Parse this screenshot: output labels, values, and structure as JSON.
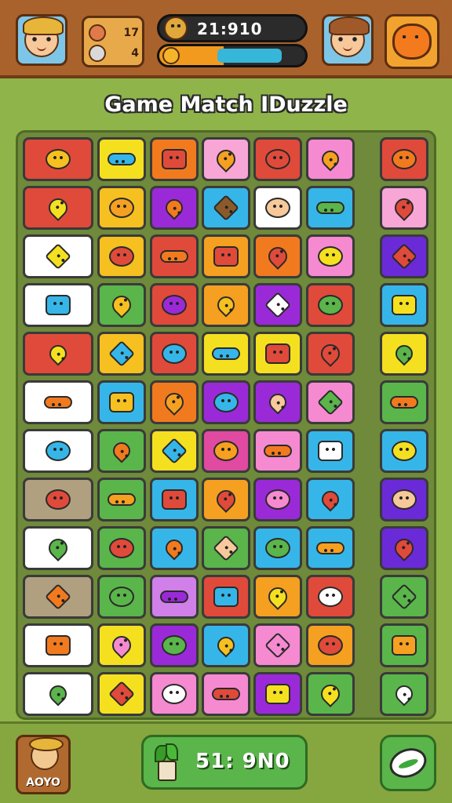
{
  "header": {
    "resources": [
      {
        "icon": "flower-icon",
        "value": "17",
        "color": "#e07a4a"
      },
      {
        "icon": "gear-icon",
        "value": "4",
        "color": "#d9d9d9"
      }
    ],
    "score_display": "21:910",
    "progress": 0.8,
    "colors": {
      "bar_bg": "#a9622c",
      "progress_orange": "#f29a1e",
      "progress_blue": "#36b6d8"
    }
  },
  "title": "Game Match IDuzzle",
  "board": {
    "columns": 8,
    "rows": 12,
    "tiles": [
      [
        "#e04a3a",
        "#f5e020",
        "#f27a1e",
        "#f7a6d6",
        "#e04a3a",
        "#f58ad0",
        "#8fb44a",
        "#e04a3a"
      ],
      [
        "#e04a3a",
        "#f5c020",
        "#9a2ad8",
        "#36b6e8",
        "#ffffff",
        "#36b6e8",
        "#8fb44a",
        "#f7a6d6"
      ],
      [
        "#ffffff",
        "#f5c020",
        "#e04a3a",
        "#f5a020",
        "#f27a1e",
        "#f58ad0",
        "#8fb44a",
        "#6a2ad8"
      ],
      [
        "#ffffff",
        "#5ab54a",
        "#e04a3a",
        "#f5a020",
        "#9a2ad8",
        "#e04a3a",
        "#8fb44a",
        "#36b6e8"
      ],
      [
        "#e04a3a",
        "#f5c020",
        "#e04a3a",
        "#f5e020",
        "#f5e020",
        "#e04a3a",
        "#8fb44a",
        "#f5e020"
      ],
      [
        "#ffffff",
        "#36b6e8",
        "#f27a1e",
        "#9a2ad8",
        "#9a2ad8",
        "#f58ad0",
        "#8fb44a",
        "#5ab54a"
      ],
      [
        "#ffffff",
        "#5ab54a",
        "#f5e020",
        "#e04aa0",
        "#f58ad0",
        "#36b6e8",
        "#8fb44a",
        "#36b6e8"
      ],
      [
        "#b0a080",
        "#5ab54a",
        "#36b6e8",
        "#f5a020",
        "#9a2ad8",
        "#36b6e8",
        "#8fb44a",
        "#6a2ad8"
      ],
      [
        "#ffffff",
        "#5ab54a",
        "#36b6e8",
        "#5ab54a",
        "#36b6e8",
        "#36b6e8",
        "#8fb44a",
        "#6a2ad8"
      ],
      [
        "#b0a080",
        "#5ab54a",
        "#d080e8",
        "#e04a3a",
        "#f5a020",
        "#e04a3a",
        "#8fb44a",
        "#5ab54a"
      ],
      [
        "#ffffff",
        "#f5e020",
        "#9a2ad8",
        "#36b6e8",
        "#f58ad0",
        "#f5a020",
        "#8fb44a",
        "#5ab54a"
      ],
      [
        "#ffffff",
        "#f5e020",
        "#f58ad0",
        "#f58ad0",
        "#9a2ad8",
        "#5ab54a",
        "#8fb44a",
        "#5ab54a"
      ]
    ],
    "glyph_colors": [
      [
        "#f5c020",
        "#36b6e8",
        "#e04a3a",
        "#f5a020",
        "#e04a3a",
        "#f5a020",
        "",
        "#f27a1e"
      ],
      [
        "#f5e020",
        "#f5a020",
        "#f27a1e",
        "#8a5a2a",
        "#f6c89a",
        "#5ab54a",
        "",
        "#e04a3a"
      ],
      [
        "#f5e020",
        "#e04a3a",
        "#f27a1e",
        "#e04a3a",
        "#e04a3a",
        "#f5e020",
        "",
        "#e04a3a"
      ],
      [
        "#36b6e8",
        "#f5c020",
        "#9a2ad8",
        "#f5c020",
        "#ffffff",
        "#5ab54a",
        "",
        "#f5e020"
      ],
      [
        "#f5e020",
        "#36b6e8",
        "#36b6e8",
        "#36b6e8",
        "#e04a3a",
        "#e04a3a",
        "",
        "#5ab54a"
      ],
      [
        "#f27a1e",
        "#f5c020",
        "#f5a020",
        "#36b6e8",
        "#f6c89a",
        "#5ab54a",
        "",
        "#f27a1e"
      ],
      [
        "#36b6e8",
        "#f27a1e",
        "#36b6e8",
        "#f5a020",
        "#f27a1e",
        "#ffffff",
        "",
        "#f5e020"
      ],
      [
        "#e04a3a",
        "#f5a020",
        "#e04a3a",
        "#e04a3a",
        "#f58ad0",
        "#e04a3a",
        "",
        "#f6c89a"
      ],
      [
        "#5ab54a",
        "#e04a3a",
        "#f27a1e",
        "#f6c89a",
        "#5ab54a",
        "#f5a020",
        "",
        "#e04a3a"
      ],
      [
        "#f27a1e",
        "#5ab54a",
        "#9a2ad8",
        "#36b6e8",
        "#f5e020",
        "#ffffff",
        "",
        "#5ab54a"
      ],
      [
        "#f27a1e",
        "#f58ad0",
        "#5ab54a",
        "#f5c020",
        "#f58ad0",
        "#e04a3a",
        "",
        "#f5a020"
      ],
      [
        "#5ab54a",
        "#e04a3a",
        "#ffffff",
        "#e04a3a",
        "#f5e020",
        "#f5e020",
        "",
        "#ffffff"
      ]
    ],
    "glyph_icons": [
      [
        "fish-icon",
        "heart-icon",
        "hat-icon",
        "banana-icon",
        "bowl-icon",
        "box-icon",
        "",
        "cookie-icon"
      ],
      [
        "fish-icon",
        "drop-icon",
        "leaf-icon",
        "chest-icon",
        "girl-icon",
        "dragon-icon",
        "",
        "lollipop-icon"
      ],
      [
        "fish-icon",
        "tomato-icon",
        "pumpkin-icon",
        "cross-icon",
        "heart-icon",
        "flower-icon",
        "",
        "apple-icon"
      ],
      [
        "speech-icon",
        "burger-icon",
        "balloon-icon",
        "smile-icon",
        "eye-icon",
        "frog-icon",
        "",
        "speech-icon"
      ],
      [
        "bird-icon",
        "gear-icon",
        "kite-icon",
        "blob-icon",
        "broom-icon",
        "face-icon",
        "",
        "ring-icon"
      ],
      [
        "popsicle-icon",
        "rocket-icon",
        "star-icon",
        "popsicle-icon",
        "cat-icon",
        "leaf-icon",
        "",
        "smile-icon"
      ],
      [
        "speech-icon",
        "brush-icon",
        "crayon-icon",
        "tower-icon",
        "orange-icon",
        "glove-icon",
        "",
        "speech-icon"
      ],
      [
        "fish-icon",
        "lock-icon",
        "flag-icon",
        "palm-icon",
        "heart-icon",
        "speech-icon",
        "",
        "bone-icon"
      ],
      [
        "fish-icon",
        "stand-icon",
        "carrot-icon",
        "face-icon",
        "hammer-icon",
        "shovel-icon",
        "",
        "magnet-icon"
      ],
      [
        "fish-icon",
        "puzzle-icon",
        "ring-icon",
        "popsicle-icon",
        "leaf-icon",
        "bun-icon",
        "",
        "letter-r-icon"
      ],
      [
        "fish-icon",
        "feather-icon",
        "bird-icon",
        "face-icon",
        "pencil-icon",
        "splat-icon",
        "",
        "tree-icon"
      ],
      [
        "fish-icon",
        "apple-icon",
        "egg-icon",
        "balloon-icon",
        "lemon-icon",
        "cube-icon",
        "",
        "trophy-icon"
      ]
    ]
  },
  "footer": {
    "player_label": "AOYO",
    "score_display": "51: 9N0",
    "action_icon": "leaf-oval-icon"
  }
}
